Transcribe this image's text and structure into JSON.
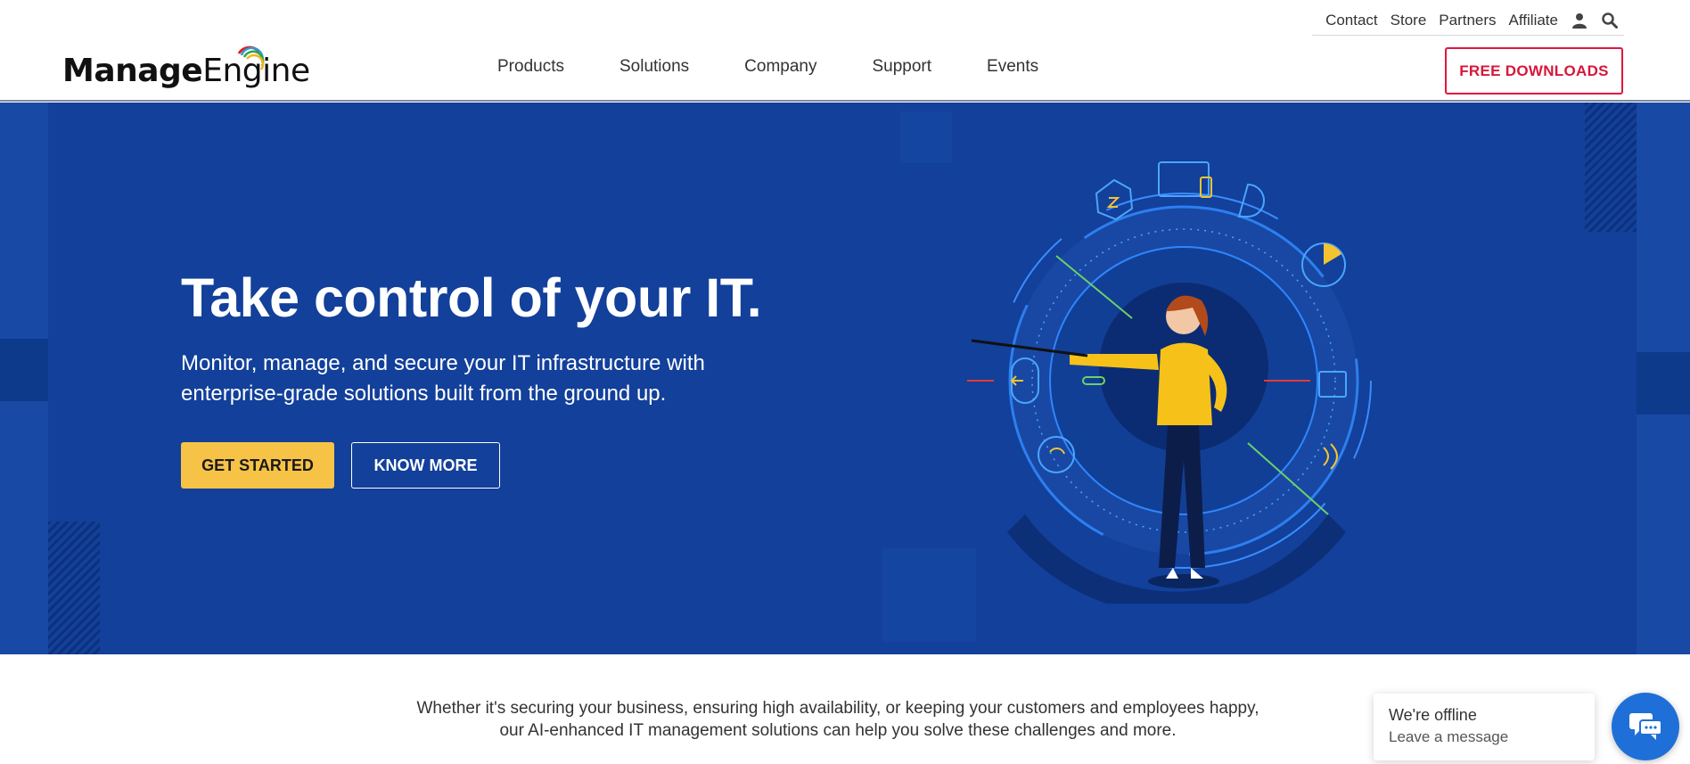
{
  "header": {
    "logo": {
      "part_bold": "Manage",
      "part_regular": "Engine"
    },
    "util_links": [
      "Contact",
      "Store",
      "Partners",
      "Affiliate"
    ],
    "util_icons": [
      "user-icon",
      "search-icon"
    ],
    "nav": [
      "Products",
      "Solutions",
      "Company",
      "Support",
      "Events"
    ],
    "cta_label": "FREE DOWNLOADS"
  },
  "hero": {
    "title": "Take control of your IT.",
    "subtitle": "Monitor, manage, and secure your IT infrastructure with enterprise-grade solutions built from the ground up.",
    "primary_button": "GET STARTED",
    "secondary_button": "KNOW MORE",
    "colors": {
      "background": "#12409a",
      "primary_button": "#f7c347"
    }
  },
  "intro": {
    "line1": "Whether it's securing your business, ensuring high availability, or keeping your customers and employees happy,",
    "line2": "our AI-enhanced IT management solutions can help you solve these challenges and more."
  },
  "chat": {
    "status": "We're offline",
    "prompt": "Leave a message",
    "icon": "chat-icon"
  },
  "colors": {
    "accent_red": "#e0173f",
    "chat_blue": "#1f6fd8"
  }
}
